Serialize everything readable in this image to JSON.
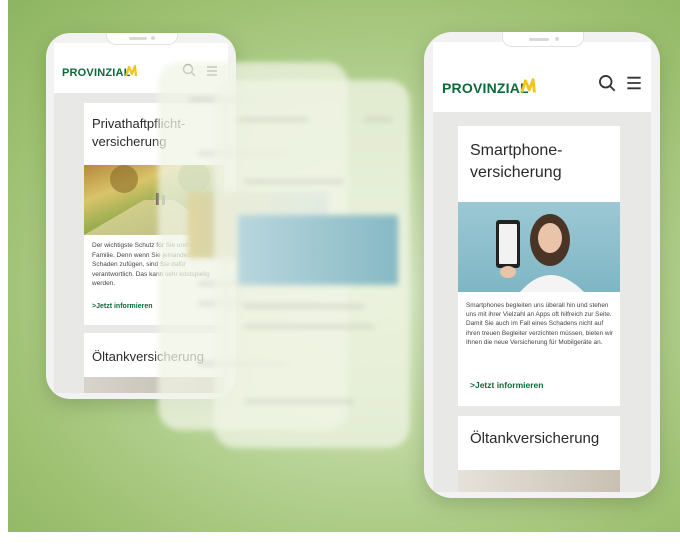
{
  "left_phone": {
    "logo": "PROVINZIAL",
    "card1_title": "Privathaftpflicht-\nversicherung",
    "card1_body": "Der wichtigste Schutz für Sie und Ihre Familie. Denn wenn Sie jemandem einen Schaden zufügen, sind Sie dafür verantwortlich. Das kann sehr kostspielig werden.",
    "card1_cta": "Jetzt informieren",
    "card2_title": "Öltankversicherung"
  },
  "right_phone": {
    "logo": "PROVINZIAL",
    "card1_title": "Smartphone-\nversicherung",
    "card1_body": "Smartphones begleiten uns überall hin und stehen uns mit ihrer Vielzahl an Apps oft hilfreich zur Seite. Damit Sie auch im Fall eines Schadens nicht auf ihren treuen Begleiter verzichten müssen, bieten wir Ihnen die neue Versicherung für Mobilgeräte an.",
    "card1_cta": "Jetzt informieren",
    "card2_title": "Öltankversicherung"
  },
  "icons": {
    "cta_arrow": ">",
    "search": "search-icon",
    "menu": "hamburger-menu-icon"
  },
  "colors": {
    "brand_green": "#0a6a3a",
    "logo_yellow": "#f2c31a",
    "background_green": "#9ec172"
  }
}
